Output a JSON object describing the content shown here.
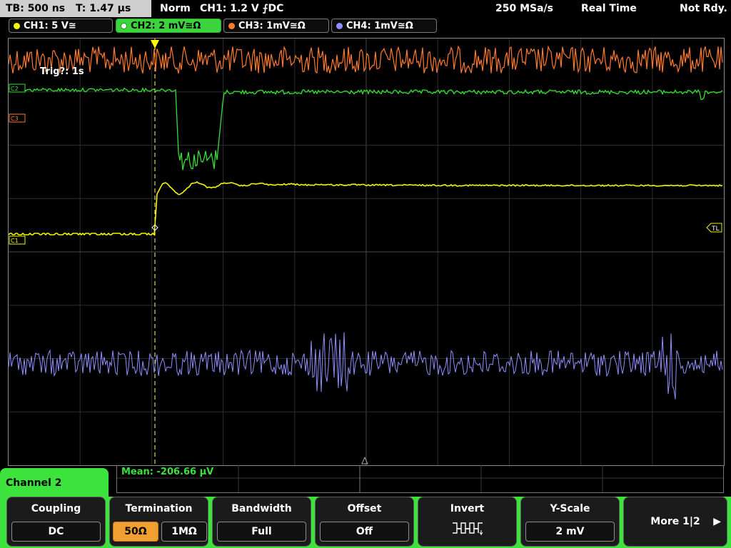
{
  "status": {
    "tb": "TB: 500 ns",
    "t": "T: 1.47 μs",
    "mode": "Norm",
    "trigger": "CH1: 1.2 V ⨍DC",
    "rate": "250 MSa/s",
    "acq": "Real Time",
    "ready": "Not Rdy."
  },
  "channels": [
    {
      "label": "CH1: 5 V≅",
      "color": "#f5f500"
    },
    {
      "label": "CH2: 2 mV≅Ω",
      "color": "#35e035"
    },
    {
      "label": "CH3: 1mV≅Ω",
      "color": "#ff7a2a"
    },
    {
      "label": "CH4: 1mV≅Ω",
      "color": "#8f8fff"
    }
  ],
  "waveform": {
    "trig_label": "Trig?: 1s",
    "marker_c1": "C1",
    "marker_c2": "C2",
    "marker_c3": "C3",
    "marker_tl": "TL"
  },
  "measurement": {
    "mean": "Mean: -206.66 μV"
  },
  "panel": {
    "title": "Channel 2"
  },
  "softkeys": {
    "coupling": {
      "label": "Coupling",
      "value": "DC"
    },
    "termination": {
      "label": "Termination",
      "opt1": "50Ω",
      "opt2": "1MΩ"
    },
    "bandwidth": {
      "label": "Bandwidth",
      "value": "Full"
    },
    "offset": {
      "label": "Offset",
      "value": "Off"
    },
    "invert": {
      "label": "Invert"
    },
    "yscale": {
      "label": "Y-Scale",
      "value": "2 mV"
    },
    "more": {
      "label": "More 1|2"
    }
  }
}
